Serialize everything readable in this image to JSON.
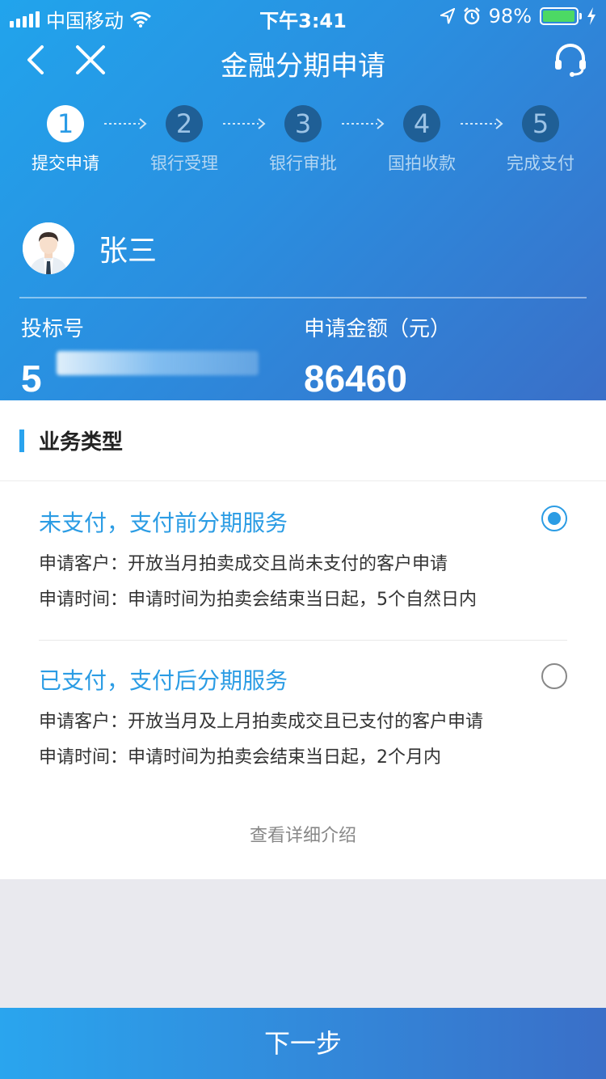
{
  "status_bar": {
    "carrier": "中国移动",
    "time": "下午3:41",
    "battery": "98%",
    "battery_level": 0.98
  },
  "nav": {
    "title": "金融分期申请"
  },
  "steps": [
    {
      "number": "1",
      "label": "提交申请",
      "active": true
    },
    {
      "number": "2",
      "label": "银行受理",
      "active": false
    },
    {
      "number": "3",
      "label": "银行审批",
      "active": false
    },
    {
      "number": "4",
      "label": "国拍收款",
      "active": false
    },
    {
      "number": "5",
      "label": "完成支付",
      "active": false
    }
  ],
  "user": {
    "name": "张三"
  },
  "bid": {
    "label": "投标号",
    "value": "5"
  },
  "amount": {
    "label": "申请金额（元）",
    "value": "86460"
  },
  "section": {
    "title": "业务类型"
  },
  "options": [
    {
      "title": "未支付，支付前分期服务",
      "customer": "申请客户：开放当月拍卖成交且尚未支付的客户申请",
      "time": "申请时间：申请时间为拍卖会结束当日起，5个自然日内",
      "checked": true
    },
    {
      "title": "已支付，支付后分期服务",
      "customer": "申请客户：开放当月及上月拍卖成交且已支付的客户申请",
      "time": "申请时间：申请时间为拍卖会结束当日起，2个月内",
      "checked": false
    }
  ],
  "more_link": "查看详细介绍",
  "footer": {
    "next_label": "下一步"
  },
  "colors": {
    "accent": "#2b9ce4",
    "header_start": "#21a4ec",
    "header_end": "#3a6fc8"
  }
}
